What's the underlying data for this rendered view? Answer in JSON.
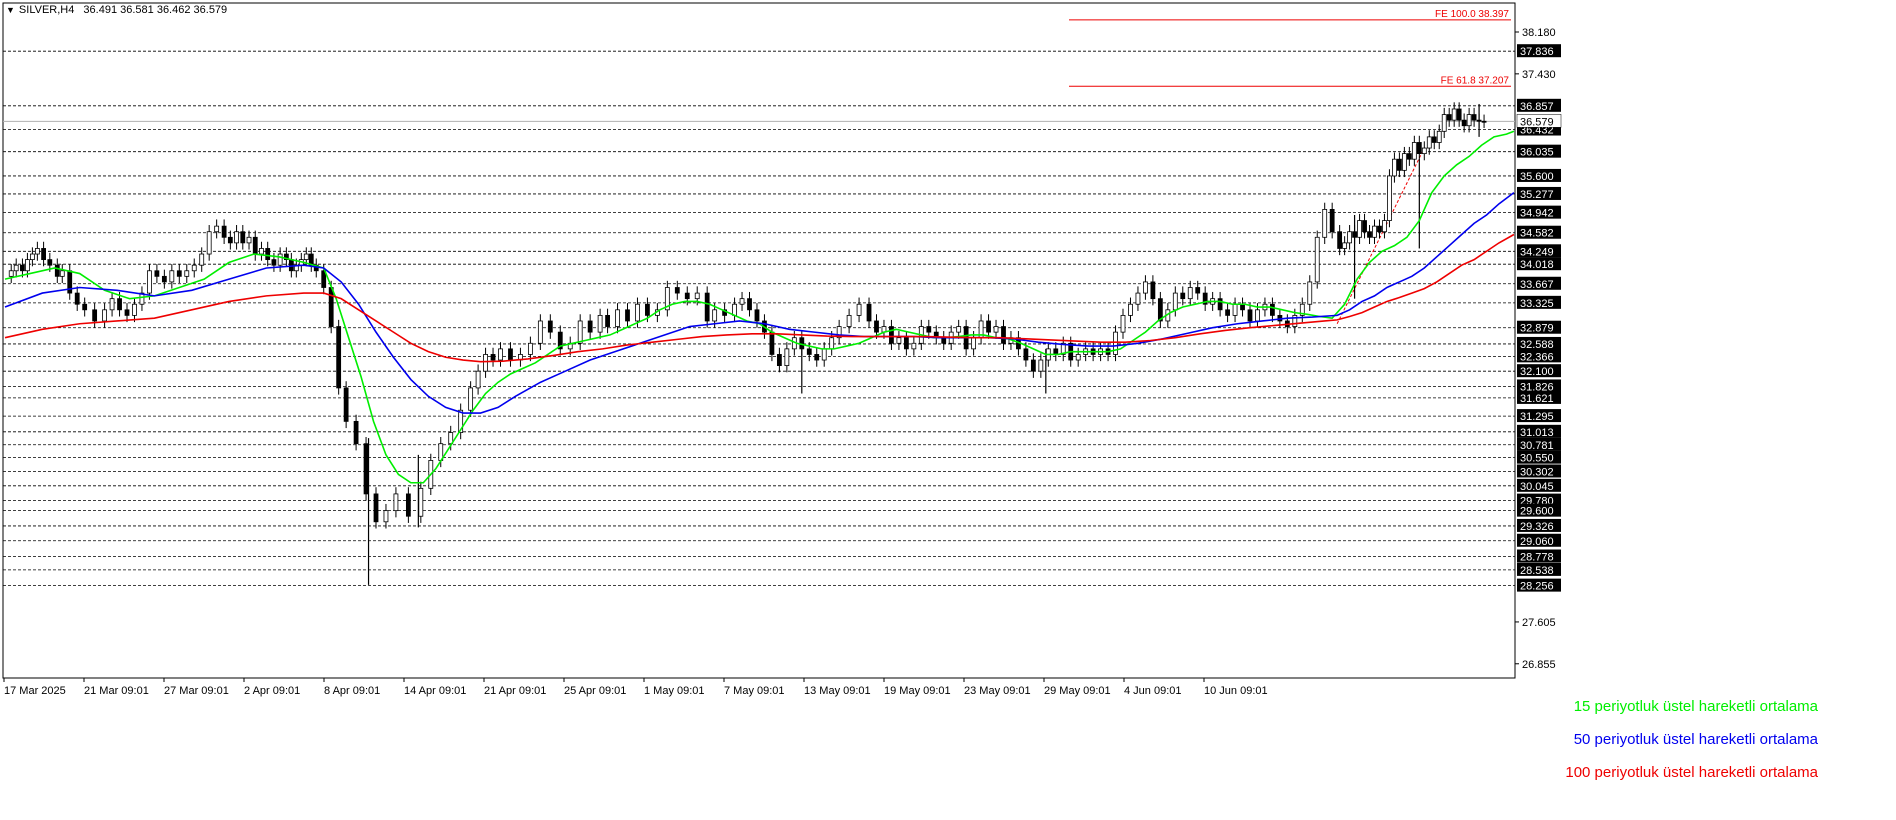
{
  "header": {
    "symbol": "SILVER,H4",
    "ohlc": "36.491 36.581 36.462 36.579"
  },
  "legend": [
    {
      "label": "15 periyotluk üstel hareketli ortalama",
      "color": "#00ee00"
    },
    {
      "label": "50 periyotluk üstel hareketli ortalama",
      "color": "#0000ee"
    },
    {
      "label": "100 periyotluk üstel hareketli ortalama",
      "color": "#ee0000"
    }
  ],
  "chart_data": {
    "type": "line",
    "title": "SILVER,H4",
    "ylim": [
      26.6,
      38.7
    ],
    "x_labels": [
      "17 Mar 2025",
      "21 Mar 09:01",
      "27 Mar 09:01",
      "2 Apr 09:01",
      "8 Apr 09:01",
      "14 Apr 09:01",
      "21 Apr 09:01",
      "25 Apr 09:01",
      "1 May 09:01",
      "7 May 09:01",
      "13 May 09:01",
      "19 May 09:01",
      "23 May 09:01",
      "29 May 09:01",
      "4 Jun 09:01",
      "10 Jun 09:01"
    ],
    "y_tick_labels": [
      "38.180",
      "37.430",
      "27.605",
      "26.855"
    ],
    "levels": [
      "37.836",
      "36.857",
      "36.432",
      "36.035",
      "35.600",
      "35.277",
      "34.942",
      "34.582",
      "34.249",
      "34.018",
      "33.667",
      "33.325",
      "32.879",
      "32.588",
      "32.366",
      "32.100",
      "31.826",
      "31.621",
      "31.295",
      "31.013",
      "30.781",
      "30.550",
      "30.302",
      "30.045",
      "29.780",
      "29.600",
      "29.326",
      "29.060",
      "28.778",
      "28.538",
      "28.256"
    ],
    "current_price": "36.579",
    "fib": [
      {
        "label": "FE 100.0 38.397",
        "value": 38.397
      },
      {
        "label": "FE 61.8 37.207",
        "value": 37.207
      }
    ],
    "price_series": {
      "x": [
        0,
        5,
        9,
        14,
        18,
        22,
        26,
        31,
        36,
        42,
        46,
        52,
        58,
        64,
        72,
        80,
        86,
        92,
        98,
        104,
        110,
        116,
        122,
        128,
        134,
        140,
        146,
        152,
        158,
        164,
        170,
        176,
        181,
        186,
        191,
        196,
        201,
        206,
        211,
        216,
        221,
        226,
        230,
        234,
        238,
        242,
        246,
        250,
        256,
        262,
        268,
        274,
        282,
        290,
        298,
        306,
        314,
        324,
        334,
        342,
        350,
        358,
        366,
        374,
        380,
        386,
        392,
        398,
        406,
        414,
        422,
        430,
        438,
        446,
        454,
        462,
        470,
        478,
        484,
        492,
        500,
        508,
        516,
        524,
        532,
        540,
        548,
        556,
        564,
        570,
        578,
        586,
        592,
        598,
        604,
        610,
        616,
        622,
        628,
        634,
        640,
        646,
        652,
        658,
        664,
        670,
        678,
        686,
        694,
        700,
        706,
        712,
        718,
        724,
        730,
        736,
        742,
        748,
        754,
        760,
        766,
        772,
        778,
        784,
        790,
        796,
        802,
        808,
        814,
        820,
        826,
        832,
        838,
        844,
        850,
        856,
        862,
        868,
        874,
        880,
        886,
        892,
        898,
        904,
        910,
        916,
        922,
        928,
        934,
        940,
        946,
        952,
        958,
        964,
        970,
        976,
        982,
        988,
        994,
        1000,
        1006,
        1012,
        1018,
        1024,
        1030,
        1036,
        1042,
        1048,
        1054,
        1060,
        1066,
        1072,
        1076,
        1080,
        1084,
        1088,
        1092,
        1096,
        1100,
        1104,
        1108,
        1112,
        1116,
        1120,
        1124,
        1128,
        1132,
        1136,
        1140,
        1144,
        1148,
        1152,
        1156,
        1160,
        1164,
        1168,
        1172,
        1176,
        1180,
        1184,
        1188,
        1192,
        1196,
        1200,
        1204,
        1208,
        1212
      ],
      "close": [
        33.8,
        33.9,
        34.0,
        33.9,
        34.1,
        34.2,
        34.3,
        34.1,
        34.0,
        33.8,
        33.9,
        33.5,
        33.3,
        33.2,
        33.0,
        33.2,
        33.4,
        33.2,
        33.1,
        33.3,
        33.5,
        33.9,
        33.8,
        33.7,
        33.9,
        33.8,
        33.9,
        34.0,
        34.2,
        34.6,
        34.7,
        34.5,
        34.4,
        34.6,
        34.4,
        34.5,
        34.2,
        34.3,
        34.1,
        34.0,
        34.2,
        34.1,
        33.9,
        34.0,
        34.1,
        34.2,
        34.0,
        33.9,
        33.6,
        32.9,
        31.8,
        31.2,
        30.8,
        29.9,
        29.4,
        29.6,
        29.9,
        29.5,
        30.0,
        30.5,
        30.8,
        31.0,
        31.4,
        31.8,
        32.1,
        32.4,
        32.3,
        32.5,
        32.3,
        32.4,
        32.6,
        33.0,
        32.8,
        32.5,
        32.6,
        33.0,
        32.8,
        33.1,
        32.9,
        33.2,
        33.0,
        33.3,
        33.1,
        33.2,
        33.6,
        33.5,
        33.4,
        33.5,
        33.0,
        33.2,
        33.1,
        33.3,
        33.4,
        33.2,
        33.0,
        32.8,
        32.4,
        32.2,
        32.5,
        32.7,
        32.5,
        32.4,
        32.3,
        32.5,
        32.7,
        32.9,
        33.1,
        33.3,
        33.0,
        32.8,
        32.9,
        32.6,
        32.7,
        32.5,
        32.6,
        32.9,
        32.8,
        32.7,
        32.6,
        32.8,
        32.9,
        32.5,
        32.7,
        33.0,
        32.8,
        32.9,
        32.6,
        32.7,
        32.5,
        32.3,
        32.1,
        32.3,
        32.5,
        32.4,
        32.6,
        32.3,
        32.4,
        32.5,
        32.4,
        32.5,
        32.4,
        32.8,
        33.1,
        33.3,
        33.5,
        33.7,
        33.4,
        33.0,
        33.2,
        33.5,
        33.4,
        33.6,
        33.5,
        33.3,
        33.4,
        33.2,
        33.1,
        33.3,
        33.2,
        33.0,
        33.2,
        33.3,
        33.1,
        33.0,
        32.9,
        33.1,
        33.3,
        33.7,
        34.5,
        35.0,
        34.6,
        34.3,
        34.4,
        34.6,
        34.5,
        34.8,
        34.6,
        34.5,
        34.7,
        34.6,
        34.8,
        35.6,
        35.9,
        35.7,
        36.0,
        35.9,
        36.2,
        36.0,
        36.1,
        36.3,
        36.2,
        36.4,
        36.7,
        36.6,
        36.8,
        36.6,
        36.5,
        36.7,
        36.6,
        36.58,
        36.579
      ],
      "ranges": [
        {
          "x": 292,
          "low": 28.27,
          "high": 30.9
        },
        {
          "x": 332,
          "low": 29.3,
          "high": 30.6
        },
        {
          "x": 640,
          "low": 31.7,
          "high": 32.6
        },
        {
          "x": 836,
          "low": 31.7,
          "high": 32.5
        },
        {
          "x": 1084,
          "low": 33.4,
          "high": 34.9
        },
        {
          "x": 1136,
          "low": 34.3,
          "high": 35.9
        },
        {
          "x": 1184,
          "low": 36.3,
          "high": 36.89
        }
      ]
    },
    "series": [
      {
        "name": "15 periyotluk üstel hareketli ortalama",
        "color": "#00ee00",
        "x": [
          0,
          20,
          40,
          60,
          80,
          100,
          120,
          140,
          160,
          180,
          200,
          220,
          240,
          256,
          266,
          276,
          286,
          296,
          306,
          316,
          326,
          336,
          346,
          356,
          366,
          376,
          386,
          396,
          406,
          416,
          426,
          436,
          446,
          456,
          466,
          476,
          486,
          496,
          506,
          516,
          526,
          536,
          546,
          556,
          566,
          576,
          586,
          596,
          606,
          616,
          626,
          636,
          646,
          656,
          666,
          676,
          686,
          696,
          706,
          716,
          726,
          736,
          746,
          756,
          766,
          776,
          786,
          796,
          806,
          816,
          826,
          836,
          846,
          856,
          866,
          876,
          886,
          896,
          906,
          916,
          926,
          936,
          946,
          956,
          966,
          976,
          986,
          996,
          1006,
          1016,
          1026,
          1036,
          1046,
          1056,
          1066,
          1076,
          1086,
          1096,
          1106,
          1116,
          1126,
          1136,
          1146,
          1156,
          1166,
          1176,
          1186,
          1196,
          1206,
          1212
        ],
        "values": [
          33.75,
          33.85,
          33.95,
          33.85,
          33.55,
          33.4,
          33.45,
          33.6,
          33.75,
          34.05,
          34.2,
          34.15,
          34.05,
          33.95,
          33.4,
          32.7,
          32.0,
          31.2,
          30.6,
          30.25,
          30.1,
          30.1,
          30.35,
          30.7,
          31.05,
          31.4,
          31.7,
          31.9,
          32.05,
          32.15,
          32.25,
          32.4,
          32.55,
          32.6,
          32.65,
          32.7,
          32.75,
          32.85,
          32.95,
          33.05,
          33.2,
          33.3,
          33.35,
          33.35,
          33.3,
          33.2,
          33.1,
          33.0,
          32.95,
          32.8,
          32.7,
          32.6,
          32.55,
          32.5,
          32.5,
          32.55,
          32.6,
          32.7,
          32.8,
          32.85,
          32.8,
          32.75,
          32.7,
          32.7,
          32.72,
          32.75,
          32.75,
          32.7,
          32.68,
          32.6,
          32.5,
          32.4,
          32.4,
          32.45,
          32.45,
          32.45,
          32.45,
          32.5,
          32.65,
          32.8,
          33.0,
          33.15,
          33.25,
          33.3,
          33.35,
          33.35,
          33.3,
          33.3,
          33.25,
          33.25,
          33.2,
          33.15,
          33.12,
          33.08,
          33.05,
          33.3,
          33.75,
          34.05,
          34.25,
          34.35,
          34.5,
          34.8,
          35.3,
          35.6,
          35.8,
          35.95,
          36.15,
          36.3,
          36.35,
          36.4
        ]
      },
      {
        "name": "50 periyotluk üstel hareketli ortalama",
        "color": "#0000ee",
        "x": [
          0,
          30,
          60,
          90,
          120,
          150,
          180,
          210,
          240,
          256,
          270,
          284,
          298,
          312,
          326,
          340,
          354,
          368,
          382,
          396,
          410,
          430,
          450,
          470,
          490,
          510,
          530,
          550,
          570,
          590,
          610,
          630,
          650,
          670,
          690,
          710,
          730,
          750,
          770,
          790,
          810,
          830,
          850,
          870,
          890,
          910,
          930,
          950,
          970,
          990,
          1010,
          1030,
          1050,
          1070,
          1080,
          1090,
          1100,
          1110,
          1120,
          1130,
          1140,
          1150,
          1160,
          1170,
          1180,
          1190,
          1200,
          1212
        ],
        "values": [
          33.25,
          33.5,
          33.6,
          33.55,
          33.45,
          33.55,
          33.75,
          33.95,
          34.0,
          33.95,
          33.7,
          33.3,
          32.8,
          32.35,
          31.95,
          31.65,
          31.45,
          31.35,
          31.35,
          31.45,
          31.65,
          31.9,
          32.1,
          32.3,
          32.45,
          32.6,
          32.75,
          32.9,
          32.95,
          33.0,
          32.95,
          32.85,
          32.8,
          32.75,
          32.72,
          32.72,
          32.72,
          32.7,
          32.7,
          32.7,
          32.68,
          32.62,
          32.58,
          32.55,
          32.55,
          32.6,
          32.68,
          32.78,
          32.88,
          32.95,
          33.0,
          33.05,
          33.07,
          33.1,
          33.2,
          33.35,
          33.45,
          33.6,
          33.7,
          33.8,
          33.95,
          34.15,
          34.35,
          34.55,
          34.75,
          34.9,
          35.1,
          35.3
        ]
      },
      {
        "name": "100 periyotluk üstel hareketli ortalama",
        "color": "#ee0000",
        "x": [
          0,
          30,
          60,
          90,
          120,
          150,
          180,
          210,
          240,
          256,
          270,
          284,
          298,
          312,
          326,
          340,
          354,
          368,
          382,
          400,
          420,
          440,
          460,
          480,
          500,
          520,
          540,
          560,
          580,
          600,
          620,
          640,
          660,
          680,
          700,
          720,
          740,
          760,
          780,
          800,
          820,
          840,
          860,
          880,
          900,
          920,
          940,
          960,
          980,
          1000,
          1020,
          1040,
          1060,
          1070,
          1080,
          1090,
          1100,
          1110,
          1120,
          1130,
          1140,
          1150,
          1160,
          1170,
          1180,
          1190,
          1200,
          1212
        ],
        "values": [
          32.7,
          32.85,
          32.95,
          33.0,
          33.05,
          33.2,
          33.35,
          33.45,
          33.5,
          33.5,
          33.4,
          33.2,
          33.0,
          32.8,
          32.6,
          32.45,
          32.35,
          32.3,
          32.27,
          32.28,
          32.32,
          32.38,
          32.45,
          32.5,
          32.57,
          32.62,
          32.67,
          32.72,
          32.75,
          32.77,
          32.77,
          32.75,
          32.73,
          32.72,
          32.72,
          32.72,
          32.72,
          32.71,
          32.7,
          32.7,
          32.68,
          32.66,
          32.64,
          32.62,
          32.62,
          32.65,
          32.7,
          32.77,
          32.83,
          32.88,
          32.92,
          32.96,
          33.0,
          33.02,
          33.08,
          33.15,
          33.25,
          33.35,
          33.42,
          33.5,
          33.58,
          33.7,
          33.85,
          34.0,
          34.1,
          34.25,
          34.4,
          34.55
        ]
      }
    ],
    "fe_projection": {
      "x": [
        1070,
        1140
      ],
      "values": [
        32.95,
        36.1
      ]
    }
  }
}
